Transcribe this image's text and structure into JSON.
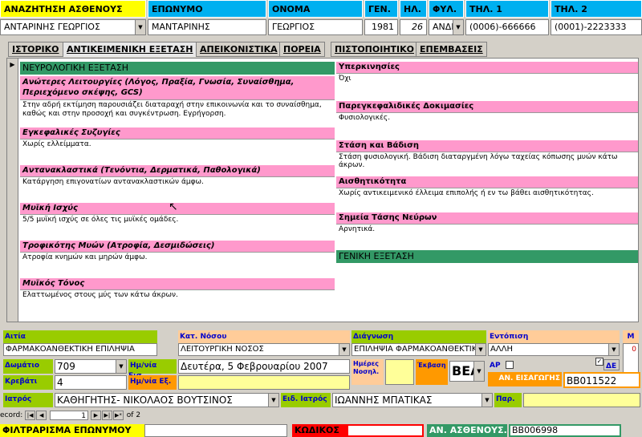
{
  "header": {
    "search_patient_label": "ΑΝΑΖΗΤΗΣΗ ΑΣΘΕΝΟΥΣ",
    "search_patient_value": "ΑΝΤΑΡΙΝΗΣ ΓΕΩΡΓΙΟΣ",
    "surname_label": "ΕΠΩΝΥΜΟ",
    "surname_value": "ΜΑΝΤΑΡΙΝΗΣ",
    "name_label": "ΟΝΟΜΑ",
    "name_value": "ΓΕΩΡΓΙΟΣ",
    "birth_label": "ΓΕΝ.",
    "birth_value": "1981",
    "age_label": "ΗΛ.",
    "age_value": "26",
    "sex_label": "ΦΥΛ.",
    "sex_value": "ΑΝΔΙ",
    "phone1_label": "ΤΗΛ. 1",
    "phone1_value": "(0006)-666666",
    "phone2_label": "ΤΗΛ. 2",
    "phone2_value": "(0001)-2223333"
  },
  "tabs": [
    {
      "label": "ΙΣΤΟΡΙΚΟ"
    },
    {
      "label": "ΑΝΤΙΚΕΙΜΕΝΙΚΗ ΕΞΕΤΑΣΗ"
    },
    {
      "label": "ΑΠΕΙΚΟΝΙΣΤΙΚΑ"
    },
    {
      "label": "ΠΟΡΕΙΑ"
    },
    {
      "label": "ΠΙΣΤΟΠΟΙΗΤΙΚΟ"
    },
    {
      "label": "ΕΠΕΜΒΑΣΕΙΣ"
    }
  ],
  "left": {
    "section_title": "ΝΕΥΡΟΛΟΓΙΚΗ ΕΞΕΤΑΣΗ",
    "items": [
      {
        "label": "Ανώτερες Λειτουργίες (Λόγος, Πραξία, Γνωσία, Συναίσθημα, Περιεχόμενο σκέψης, GCS)",
        "text": "Στην αδρή εκτίμηση παρουσιάζει διαταραχή στην επικοινωνία και το συναίσθημα, καθώς και στην προσοχή και συγκέντρωση. Εγρήγορση."
      },
      {
        "label": "Εγκεφαλικές Συζυγίες",
        "text": "Χωρίς ελλείμματα."
      },
      {
        "label": "Αντανακλαστικά (Τενόντια, Δερματικά, Παθολογικά)",
        "text": "Κατάργηση επιγονατίων αντανακλαστικών άμφω."
      },
      {
        "label": "Μυϊκή Ισχύς",
        "text": "5/5 μυϊκή ισχύς σε όλες τις μυϊκές ομάδες."
      },
      {
        "label": "Τροφικότης Μυών  (Ατροφία, Δεσμιδώσεις)",
        "text": "Ατροφία κνημών και μηρών άμφω."
      },
      {
        "label": "Μυϊκός Τόνος",
        "text": "Ελαττωμένος στους μύς των κάτω άκρων."
      }
    ]
  },
  "right": {
    "items": [
      {
        "label": "Υπερκινησίες",
        "text": "Όχι"
      },
      {
        "label": "Παρεγκεφαλιδικές Δοκιμασίες",
        "text": "Φυσιολογικές."
      },
      {
        "label": "Στάση και Βάδιση",
        "text": "Στάση φυσιολογική. Βάδιση διαταργμένη λόγω ταχείας κόπωσης μυών κάτω άκρων."
      },
      {
        "label": "Αισθητικότητα",
        "text": "Χωρίς αντικειμενικό έλλειμα επιπολής ή εν τω βάθει αισθητικότητας."
      },
      {
        "label": "Σημεία Τάσης Νεύρων",
        "text": "Αρνητικά."
      }
    ],
    "general_title": "ΓΕΝΙΚΗ ΕΞΕΤΑΣΗ"
  },
  "bottom": {
    "cause_label": "Αιτία",
    "cause_value": "ΦΑΡΜΑΚΟΑΝΘΕΚΤΙΚΗ ΕΠΙΛΗΨΙΑ",
    "disease_cat_label": "Κατ. Νόσου",
    "disease_cat_value": "ΛΕΙΤΟΥΡΓΙΚΗ ΝΟΣΟΣ",
    "diagnosis_label": "Διάγνωση",
    "diagnosis_value": "ΕΠΙΛΗΨΙΑ ΦΑΡΜΑΚΟΑΝΘΕΚΤΙΚΗ",
    "location_label": "Εντόπιση",
    "location_value": "ΑΛΛΗ",
    "m_label": "Μ",
    "m_value": "0",
    "room_label": "Δωμάτιο",
    "room_value": "709",
    "admit_date_label": "Ημ/νία Εισ.",
    "admit_date_value": "Δευτέρα, 5 Φεβρουαρίου 2007",
    "hosp_days_label": "Ημέρες Νοσηλ.",
    "outcome_label": "Έκβαση",
    "outcome_value": "ΒΕΛ",
    "ar_label": "ΑΡ",
    "de_label": "ΔΕ",
    "bed_label": "Κρεβάτι",
    "bed_value": "4",
    "exit_date_label": "Ημ/νία Εξ.",
    "admit_no_label": "ΑΝ. ΕΙΣΑΓΩΓΗΣ",
    "admit_no_value": "ΒΒ011522",
    "doctor_label": "Ιατρός",
    "doctor_value": "ΚΑΘΗΓΗΤΗΣ- ΝΙΚΟΛΑΟΣ ΒΟΥΤΣΙΝΟΣ",
    "spec_doctor_label": "Ειδ. Ιατρός",
    "spec_doctor_value": "ΙΩΑΝΝΗΣ ΜΠΑΤΙΚΑΣ",
    "par_label": "Παρ."
  },
  "record_nav": {
    "label": "ecord:",
    "current": "1",
    "of_text": "of  2"
  },
  "footer": {
    "filter_label": "ΦΙΛΤΡΑΡΙΣΜΑ ΕΠΩΝΥΜΟΥ",
    "code_label": "ΚΩΔΙΚΟΣ",
    "patient_no_label": "ΑΝ. ΑΣΘΕΝΟΥΣ.",
    "patient_no_value": "ΒΒ006998"
  }
}
